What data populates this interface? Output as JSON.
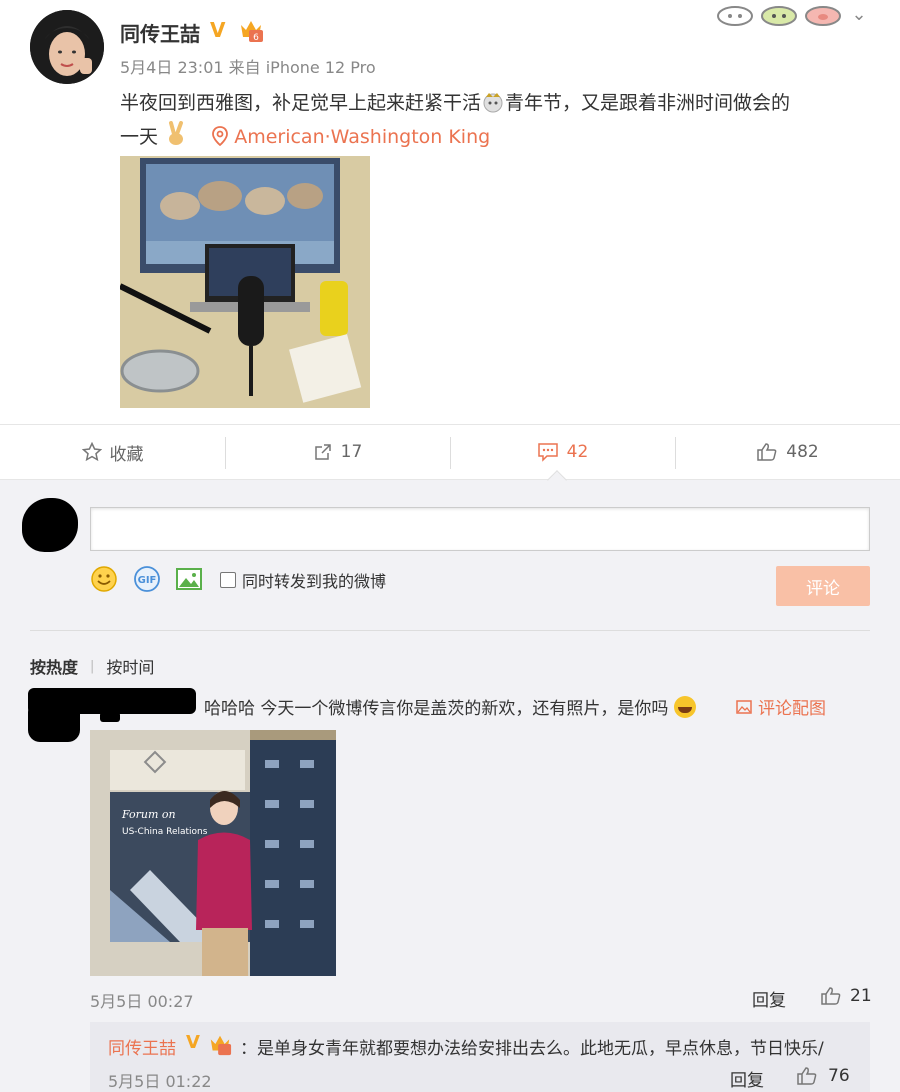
{
  "post": {
    "author": "同传王喆",
    "verified_badge": "V",
    "meta": "5月4日 23:01 来自 iPhone 12 Pro",
    "text_line1": "半夜回到西雅图，补足觉早上起来赶紧干活",
    "text_line1b": "青年节，又是跟着非洲时间做会的",
    "text_line2": "一天",
    "location": "American·Washington King",
    "icons": [
      "crown-emoji-icon",
      "victory-hand-icon",
      "location-pin-icon"
    ]
  },
  "actions": {
    "favorite_label": "收藏",
    "repost_count": "17",
    "comment_count": "42",
    "like_count": "482"
  },
  "composer": {
    "forward_label": "同时转发到我的微博",
    "submit_label": "评论",
    "tools": [
      "emoji-icon",
      "gif-icon",
      "image-icon"
    ]
  },
  "sort": {
    "hot_label": "按热度",
    "time_label": "按时间"
  },
  "comment": {
    "text": "哈哈哈 今天一个微博传言你是盖茨的新欢，还有照片，是你吗",
    "pic_link_label": "评论配图",
    "time": "5月5日 00:27",
    "reply_label": "回复",
    "like_count": "21",
    "image_text_forum": "Forum on",
    "image_text_sub": "US-China Relations"
  },
  "reply": {
    "author": "同传王喆",
    "verified_badge": "V",
    "text": "：是单身女青年就都要想办法给安排出去么。此地无瓜，早点休息，节日快乐/",
    "time": "5月5日 01:22",
    "reply_label": "回复",
    "like_count": "76"
  },
  "colors": {
    "accent": "#eb7350",
    "verified": "#f5a623",
    "submit_disabled": "#f9c0a6",
    "background": "#f2f2f5"
  }
}
